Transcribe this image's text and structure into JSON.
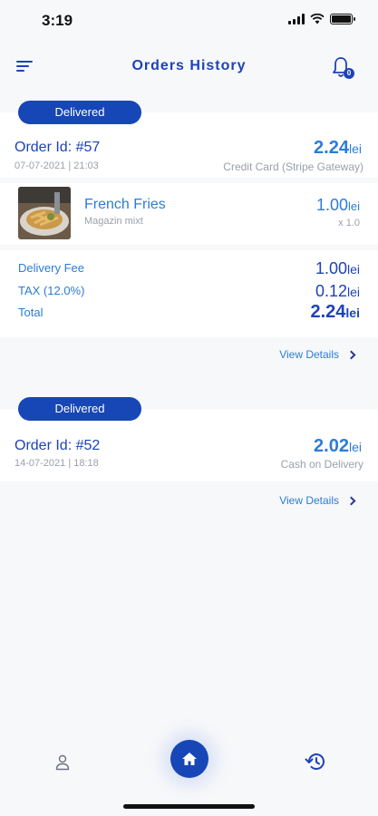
{
  "status_bar": {
    "time": "3:19"
  },
  "header": {
    "title": "Orders History",
    "notification_count": "0"
  },
  "orders": [
    {
      "status": "Delivered",
      "order_id": "Order Id: #57",
      "date": "07-07-2021 | 21:03",
      "amount": "2.24",
      "currency": "lei",
      "payment_method": "Credit Card (Stripe Gateway)",
      "items": [
        {
          "name": "French Fries",
          "shop": "Magazin mixt",
          "price": "1.00",
          "currency": "lei",
          "qty": "x 1.0"
        }
      ],
      "summary": {
        "delivery_fee_label": "Delivery Fee",
        "delivery_fee": "1.00",
        "tax_label": "TAX (12.0%)",
        "tax": "0.12",
        "total_label": "Total",
        "total": "2.24",
        "currency": "lei"
      },
      "view_details": "View Details"
    },
    {
      "status": "Delivered",
      "order_id": "Order Id: #52",
      "date": "14-07-2021 | 18:18",
      "amount": "2.02",
      "currency": "lei",
      "payment_method": "Cash on Delivery",
      "view_details": "View Details"
    }
  ],
  "colors": {
    "primary": "#1746b6",
    "accent": "#2c7cd6",
    "muted": "#9aa0ab",
    "background": "#f7f8fa"
  },
  "icons": {
    "menu": "menu-icon",
    "notifications": "bell-icon",
    "chevron": "chevron-right-icon",
    "profile": "person-icon",
    "home": "home-icon",
    "history": "history-icon"
  }
}
